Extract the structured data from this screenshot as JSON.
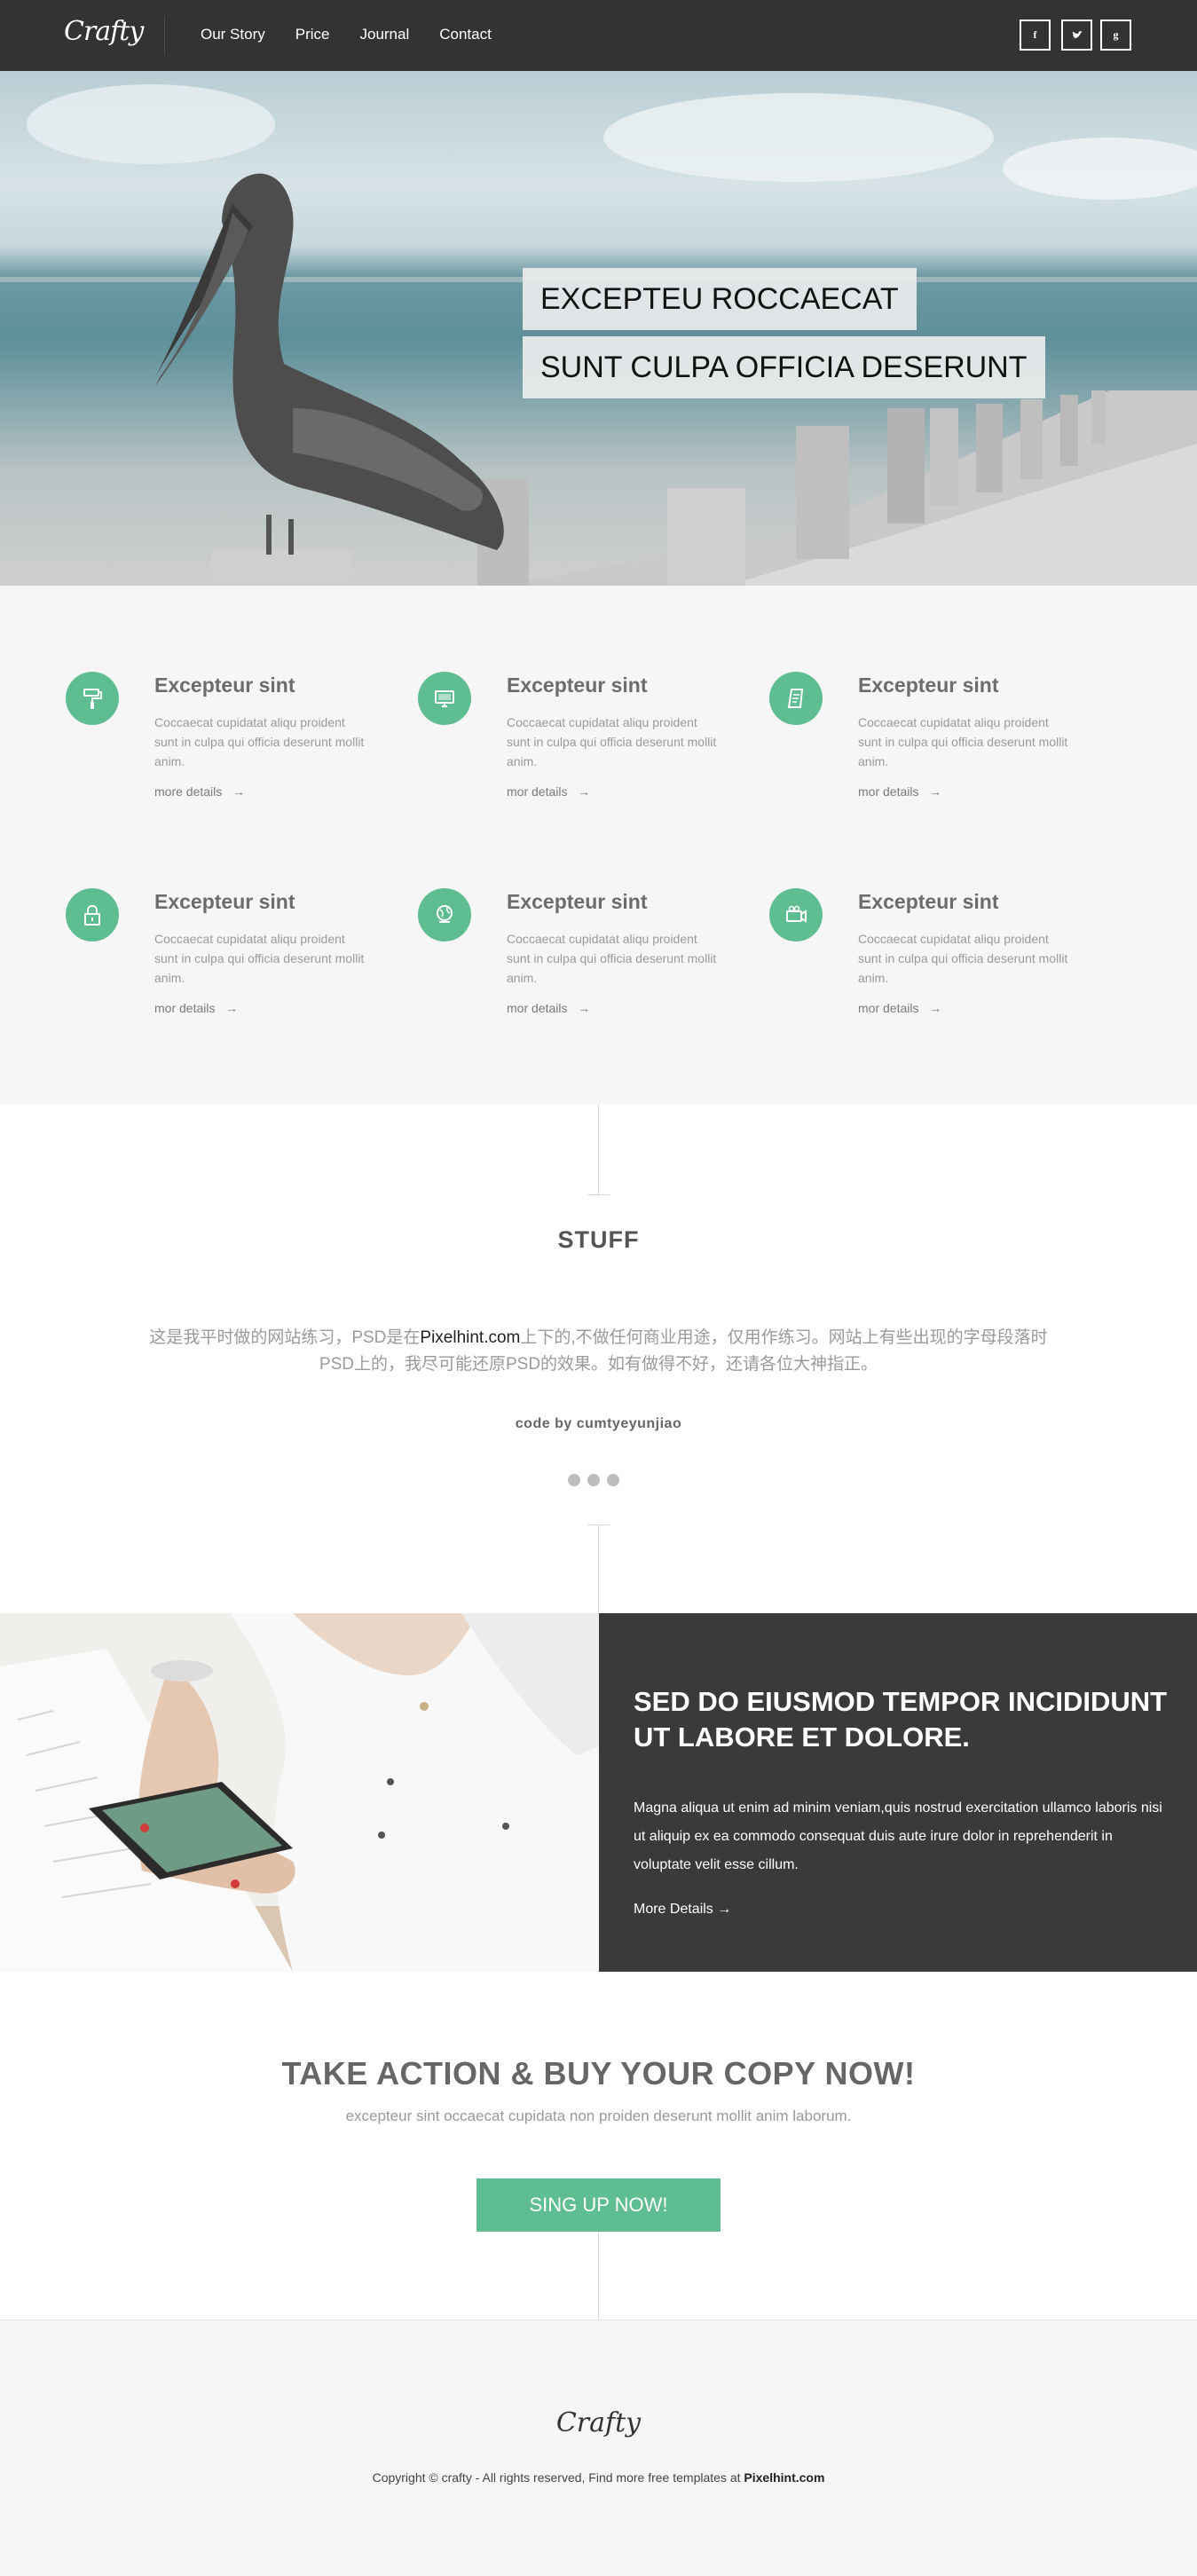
{
  "nav": {
    "logo": "Crafty",
    "links": [
      "Our Story",
      "Price",
      "Journal",
      "Contact"
    ],
    "social": [
      "f",
      "t",
      "g"
    ]
  },
  "hero": {
    "caption_line1": "EXCEPTEU ROCCAECAT",
    "caption_line2": "SUNT CULPA OFFICIA DESERUNT"
  },
  "features": [
    {
      "icon": "paint-roller-icon",
      "title": "Excepteur sint",
      "text": "Coccaecat cupidatat aliqu proident sunt in culpa qui officia deserunt mollit anim.",
      "more": "more details"
    },
    {
      "icon": "monitor-icon",
      "title": "Excepteur sint",
      "text": "Coccaecat cupidatat aliqu proident sunt in culpa qui officia deserunt mollit anim.",
      "more": "mor details"
    },
    {
      "icon": "document-icon",
      "title": "Excepteur sint",
      "text": "Coccaecat cupidatat aliqu proident sunt in culpa qui officia deserunt mollit anim.",
      "more": "mor details"
    },
    {
      "icon": "lock-icon",
      "title": "Excepteur sint",
      "text": "Coccaecat cupidatat aliqu proident sunt in culpa qui officia deserunt mollit anim.",
      "more": "mor details"
    },
    {
      "icon": "globe-icon",
      "title": "Excepteur sint",
      "text": "Coccaecat cupidatat aliqu proident sunt in culpa qui officia deserunt mollit anim.",
      "more": "mor details"
    },
    {
      "icon": "video-camera-icon",
      "title": "Excepteur sint",
      "text": "Coccaecat cupidatat aliqu proident sunt in culpa qui officia deserunt mollit anim.",
      "more": "mor details"
    }
  ],
  "arrow": "→",
  "stuff": {
    "title": "STUFF",
    "text_before": "这是我平时做的网站练习，PSD是在",
    "text_highlight": "Pixelhint.com",
    "text_after": "上下的,不做任何商业用途，仅用作练习。网站上有些出现的字母段落时PSD上的，我尽可能还原PSD的效果。如有做得不好，还请各位大神指正。",
    "code": "code by cumtyeyunjiao"
  },
  "split": {
    "title": "SED DO EIUSMOD TEMPOR INCIDIDUNT UT LABORE ET DOLORE.",
    "text": "Magna aliqua ut enim ad minim veniam,quis nostrud exercitation ullamco laboris nisi ut aliquip ex ea commodo consequat duis aute irure dolor in reprehenderit in voluptate velit esse cillum.",
    "more": "More Details →"
  },
  "cta": {
    "title": "TAKE ACTION & BUY YOUR COPY NOW!",
    "subtitle": "excepteur sint occaecat cupidata non proiden deserunt mollit anim laborum.",
    "button": "SING UP NOW!"
  },
  "footer": {
    "logo": "Crafty",
    "copy_text": "Copyright © crafty - All rights reserved, Find more free templates at ",
    "copy_link": "Pixelhint.com"
  },
  "colors": {
    "nav_bg": "#333333",
    "accent": "#5fbd92",
    "dark_panel": "#3a3a3a",
    "light_bg": "#f6f6f6"
  }
}
